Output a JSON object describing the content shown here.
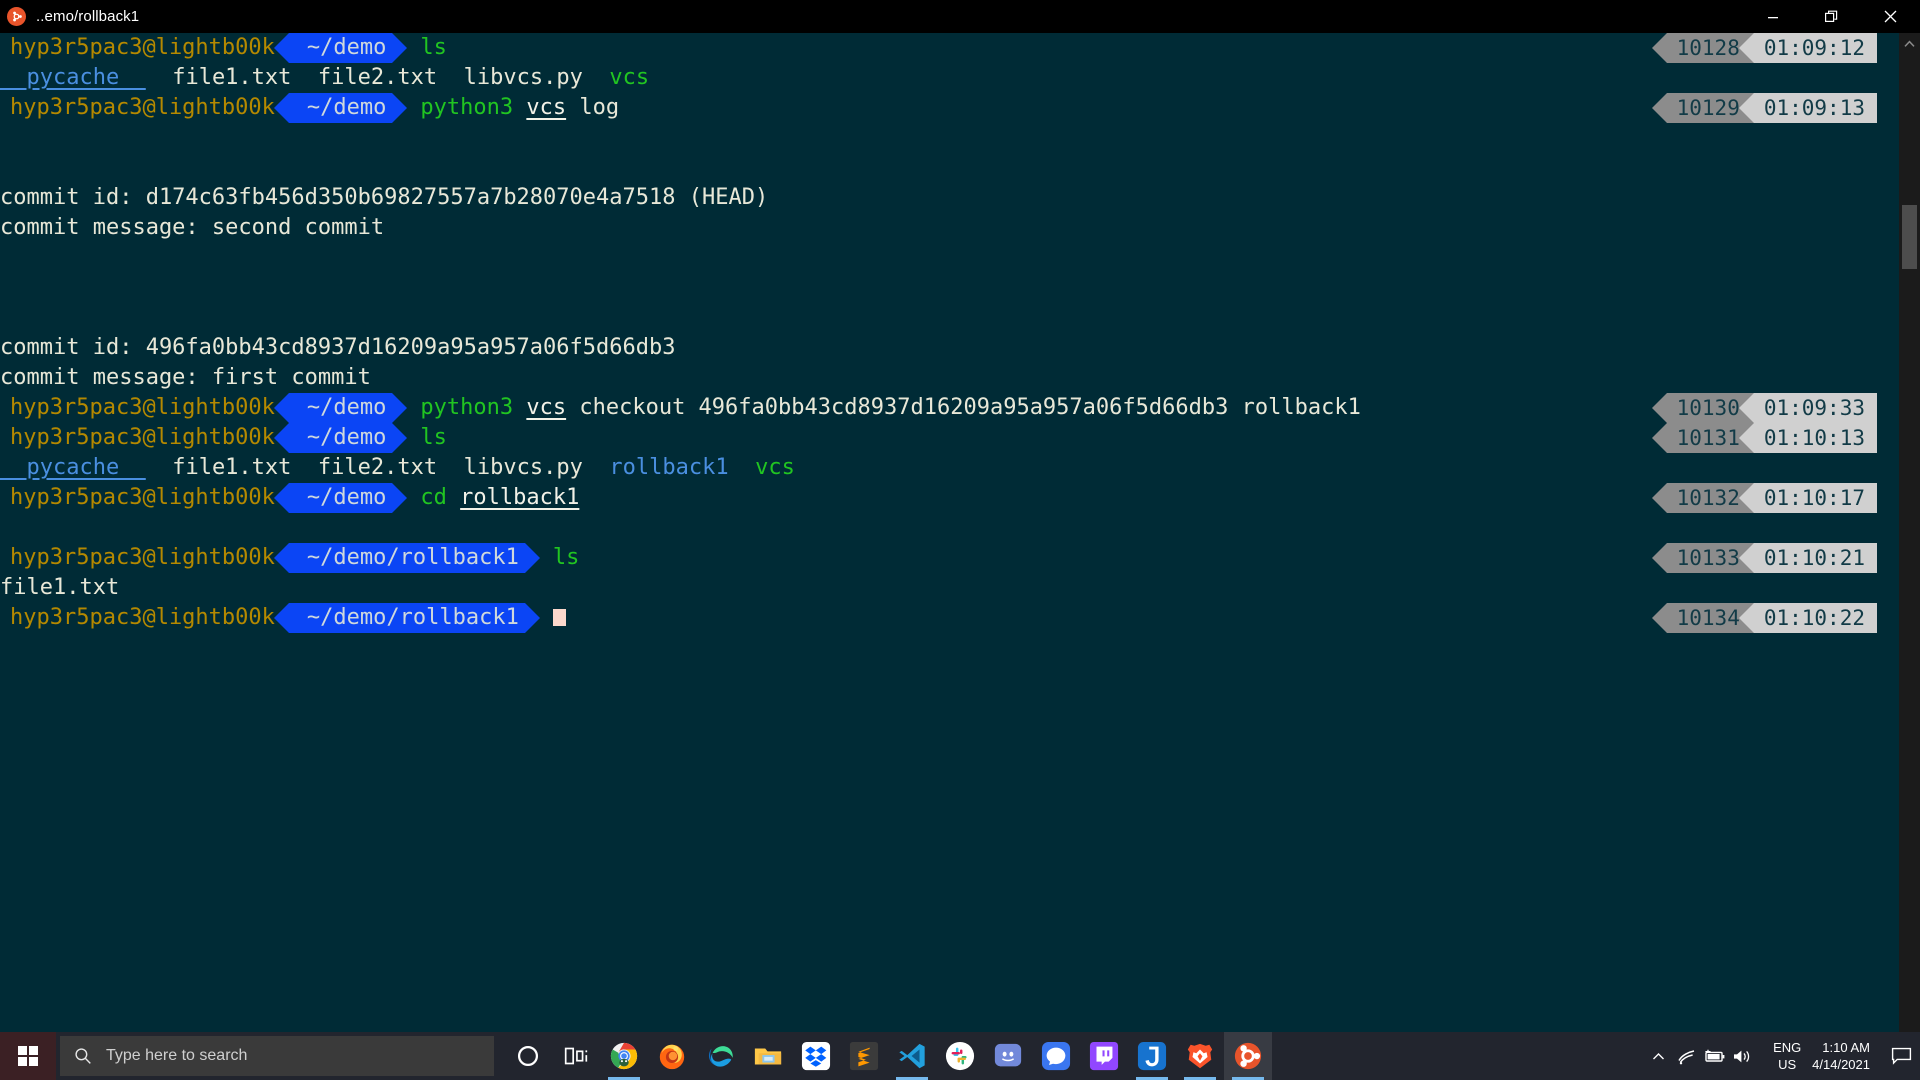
{
  "window": {
    "title": "..emo/rollback1",
    "app_icon": "ubuntu-icon",
    "minimize_label": "Minimize",
    "maximize_label": "Restore",
    "close_label": "Close",
    "background_color": "#002b36",
    "titlebar_color": "#000000"
  },
  "terminal": {
    "prompt": {
      "user_host": "hyp3r5pac3@lightb00k",
      "path_badge_color": "#0b45f5",
      "user_color": "#b58900"
    },
    "lines": [
      {
        "kind": "prompt",
        "user_host": "hyp3r5pac3@lightb00k",
        "path": "~/demo",
        "command": [
          {
            "text": "ls",
            "style": "green"
          }
        ],
        "badge": {
          "num": "10128",
          "time": "01:09:12"
        }
      },
      {
        "kind": "output",
        "parts": [
          {
            "text": "__pycache__",
            "style": "dir-blue-underline"
          },
          {
            "text": "  ",
            "style": "plain"
          },
          {
            "text": "file1.txt",
            "style": "plain"
          },
          {
            "text": "  ",
            "style": "plain"
          },
          {
            "text": "file2.txt",
            "style": "plain"
          },
          {
            "text": "  ",
            "style": "plain"
          },
          {
            "text": "libvcs.py",
            "style": "plain"
          },
          {
            "text": "  ",
            "style": "plain"
          },
          {
            "text": "vcs",
            "style": "green"
          }
        ]
      },
      {
        "kind": "prompt",
        "user_host": "hyp3r5pac3@lightb00k",
        "path": "~/demo",
        "command": [
          {
            "text": "python3",
            "style": "green"
          },
          {
            "text": " ",
            "style": "plain"
          },
          {
            "text": "vcs",
            "style": "white-underline"
          },
          {
            "text": " log",
            "style": "plain"
          }
        ],
        "badge": {
          "num": "10129",
          "time": "01:09:13"
        }
      },
      {
        "kind": "blank"
      },
      {
        "kind": "blank"
      },
      {
        "kind": "output",
        "parts": [
          {
            "text": "commit id: d174c63fb456d350b69827557a7b28070e4a7518 (HEAD)",
            "style": "plain"
          }
        ]
      },
      {
        "kind": "output",
        "parts": [
          {
            "text": "commit message: second commit",
            "style": "plain"
          }
        ]
      },
      {
        "kind": "blank"
      },
      {
        "kind": "blank"
      },
      {
        "kind": "blank"
      },
      {
        "kind": "output",
        "parts": [
          {
            "text": "commit id: 496fa0bb43cd8937d16209a95a957a06f5d66db3",
            "style": "plain"
          }
        ]
      },
      {
        "kind": "output",
        "parts": [
          {
            "text": "commit message: first commit",
            "style": "plain"
          }
        ]
      },
      {
        "kind": "prompt",
        "user_host": "hyp3r5pac3@lightb00k",
        "path": "~/demo",
        "command": [
          {
            "text": "python3",
            "style": "green"
          },
          {
            "text": " ",
            "style": "plain"
          },
          {
            "text": "vcs",
            "style": "white-underline"
          },
          {
            "text": " checkout 496fa0bb43cd8937d16209a95a957a06f5d66db3 rollback1",
            "style": "plain"
          }
        ],
        "badge": {
          "num": "10130",
          "time": "01:09:33"
        }
      },
      {
        "kind": "prompt",
        "user_host": "hyp3r5pac3@lightb00k",
        "path": "~/demo",
        "command": [
          {
            "text": "ls",
            "style": "green"
          }
        ],
        "badge": {
          "num": "10131",
          "time": "01:10:13"
        }
      },
      {
        "kind": "output",
        "parts": [
          {
            "text": "__pycache__",
            "style": "dir-blue-underline"
          },
          {
            "text": "  ",
            "style": "plain"
          },
          {
            "text": "file1.txt",
            "style": "plain"
          },
          {
            "text": "  ",
            "style": "plain"
          },
          {
            "text": "file2.txt",
            "style": "plain"
          },
          {
            "text": "  ",
            "style": "plain"
          },
          {
            "text": "libvcs.py",
            "style": "plain"
          },
          {
            "text": "  ",
            "style": "plain"
          },
          {
            "text": "rollback1",
            "style": "dir-blue"
          },
          {
            "text": "  ",
            "style": "plain"
          },
          {
            "text": "vcs",
            "style": "green"
          }
        ]
      },
      {
        "kind": "prompt",
        "user_host": "hyp3r5pac3@lightb00k",
        "path": "~/demo",
        "command": [
          {
            "text": "cd",
            "style": "green"
          },
          {
            "text": " ",
            "style": "plain"
          },
          {
            "text": "rollback1",
            "style": "white-underline"
          }
        ],
        "badge": {
          "num": "10132",
          "time": "01:10:17"
        }
      },
      {
        "kind": "blank"
      },
      {
        "kind": "prompt",
        "user_host": "hyp3r5pac3@lightb00k",
        "path": "~/demo/rollback1",
        "command": [
          {
            "text": "ls",
            "style": "green"
          }
        ],
        "badge": {
          "num": "10133",
          "time": "01:10:21"
        }
      },
      {
        "kind": "output",
        "parts": [
          {
            "text": "file1.txt",
            "style": "plain"
          }
        ]
      },
      {
        "kind": "prompt",
        "user_host": "hyp3r5pac3@lightb00k",
        "path": "~/demo/rollback1",
        "command": [],
        "cursor": true,
        "badge": {
          "num": "10134",
          "time": "01:10:22"
        }
      }
    ]
  },
  "scrollbar": {
    "up_arrow": "chevron-up-icon",
    "down_arrow": "chevron-down-icon",
    "thumb_label": "scroll-thumb"
  },
  "taskbar": {
    "start_label": "Start",
    "search": {
      "placeholder": "Type here to search",
      "icon": "search-icon"
    },
    "pinned": [
      {
        "name": "cortana",
        "label": "Cortana",
        "active": false
      },
      {
        "name": "task-view",
        "label": "Task View",
        "active": false
      },
      {
        "name": "chrome",
        "label": "Google Chrome",
        "active": true
      },
      {
        "name": "firefox",
        "label": "Firefox",
        "active": false
      },
      {
        "name": "edge",
        "label": "Microsoft Edge",
        "active": false
      },
      {
        "name": "file-explorer",
        "label": "File Explorer",
        "active": false
      },
      {
        "name": "dropbox",
        "label": "Dropbox",
        "active": false
      },
      {
        "name": "sublime-text",
        "label": "Sublime Text",
        "active": false
      },
      {
        "name": "vs-code",
        "label": "Visual Studio Code",
        "active": true
      },
      {
        "name": "slack",
        "label": "Slack",
        "active": false
      },
      {
        "name": "discord",
        "label": "Discord",
        "active": false
      },
      {
        "name": "signal",
        "label": "Signal",
        "active": false
      },
      {
        "name": "twitch",
        "label": "Twitch",
        "active": false
      },
      {
        "name": "jdownloader",
        "label": "J",
        "active": true
      },
      {
        "name": "brave",
        "label": "Brave Browser",
        "active": true
      },
      {
        "name": "ubuntu-terminal",
        "label": "Ubuntu",
        "active": true
      }
    ],
    "tray": {
      "overflow_icon": "chevron-up-icon",
      "wifi_icon": "wifi-icon",
      "battery_icon": "battery-charging-icon",
      "volume_icon": "volume-icon",
      "language_line1": "ENG",
      "language_line2": "US",
      "time": "1:10 AM",
      "date": "4/14/2021",
      "notifications_icon": "notification-icon"
    }
  }
}
